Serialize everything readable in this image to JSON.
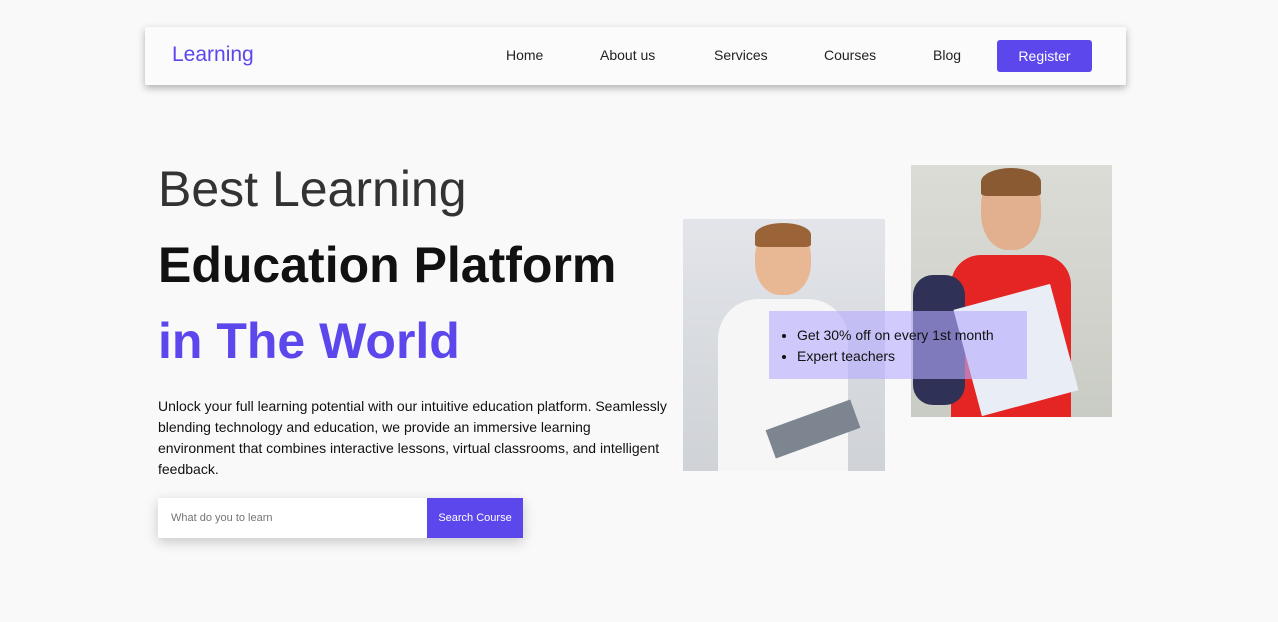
{
  "nav": {
    "logo": "Learning",
    "links": [
      "Home",
      "About us",
      "Services",
      "Courses",
      "Blog"
    ],
    "register": "Register"
  },
  "hero": {
    "line1": "Best Learning",
    "line2": "Education Platform",
    "line3": "in The World",
    "description": "Unlock your full learning potential with our intuitive education platform. Seamlessly blending technology and education, we provide an immersive learning environment that combines interactive lessons, virtual classrooms, and intelligent feedback.",
    "search": {
      "placeholder": "What do you to learn",
      "button": "Search Course"
    }
  },
  "features": [
    "Get 30% off on every 1st month",
    "Expert teachers"
  ],
  "colors": {
    "accent": "#5b47ec"
  }
}
